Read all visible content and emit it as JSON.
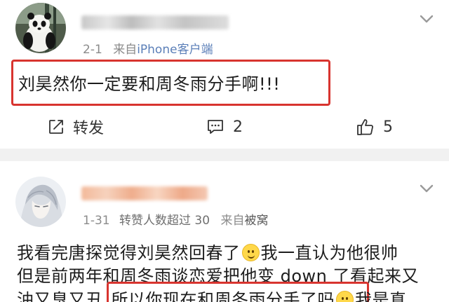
{
  "comments": [
    {
      "date": "2-1",
      "source_prefix": "来自",
      "source": "iPhone客户端",
      "text": "刘昊然你一定要和周冬雨分手啊!!!",
      "actions": {
        "repost_label": "转发",
        "comment_count": "2",
        "like_count": "5"
      }
    },
    {
      "date": "1-31",
      "badge": "转赞人数超过 30",
      "source_prefix": "来自",
      "source": "被窝",
      "line1_a": "我看完唐探觉得刘昊然回春了",
      "line1_b": "我一直认为他很帅",
      "line2": "但是前两年和周冬雨谈恋爱把他变 down 了看起来又",
      "line3_a": "油又臭又丑",
      "line3_hl": "所以你现在和周冬雨分手了吗",
      "line3_b": "我是真"
    }
  ],
  "icons": [
    "panda-avatar",
    "anime-avatar",
    "chevron-down-icon",
    "repost-icon",
    "comment-icon",
    "like-icon",
    "smile-emoji"
  ],
  "colors": {
    "highlight": "#d8342f",
    "source_link": "#5b7fb8",
    "meta": "#8b8b8b",
    "separator": "#f1f1f1"
  }
}
